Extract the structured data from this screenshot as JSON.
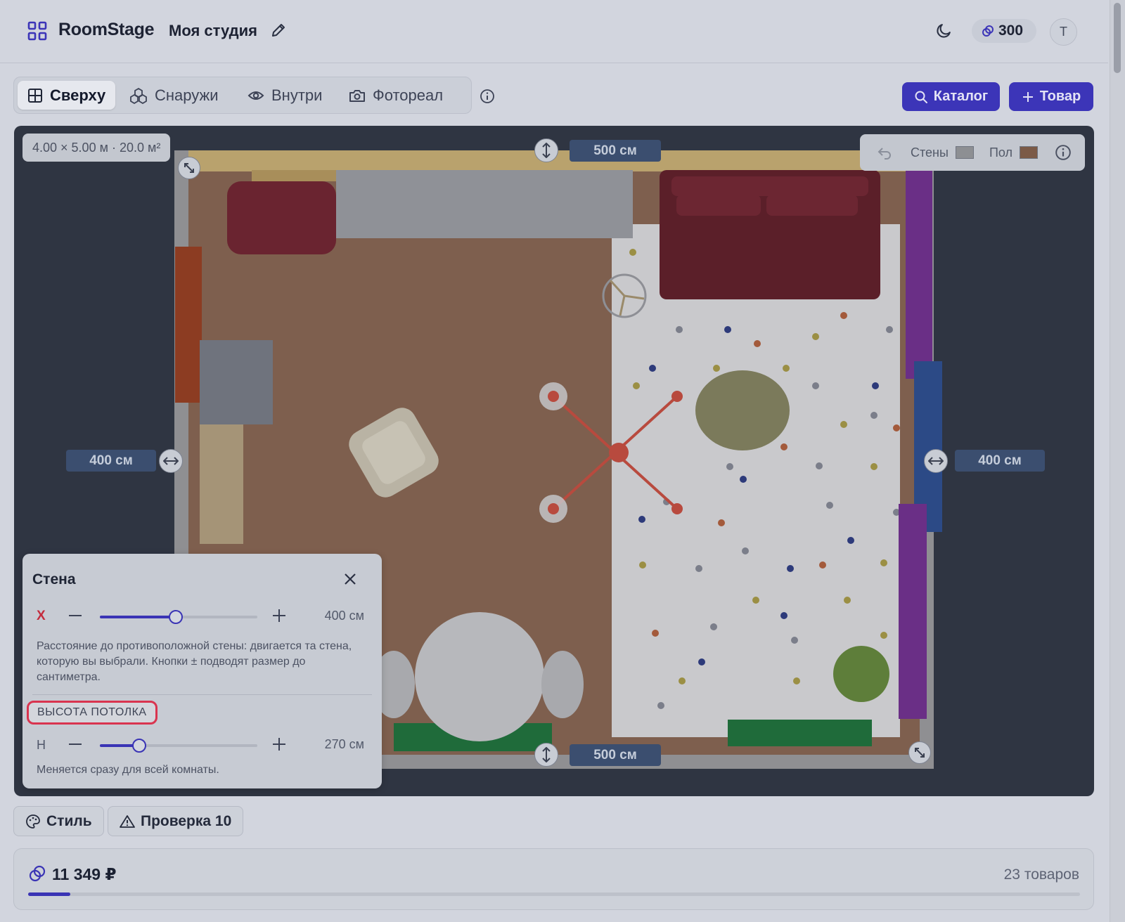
{
  "header": {
    "app_name": "RoomStage",
    "project_name": "Моя студия",
    "coins": "300",
    "avatar_letter": "T"
  },
  "view_tabs": [
    {
      "label": "Сверху",
      "icon": "grid-top-view-icon",
      "active": true
    },
    {
      "label": "Снаружи",
      "icon": "cubes-icon",
      "active": false
    },
    {
      "label": "Внутри",
      "icon": "eye-icon",
      "active": false
    },
    {
      "label": "Фотореал",
      "icon": "camera-icon",
      "active": false
    }
  ],
  "actions": {
    "catalog_label": "Каталог",
    "add_item_label": "Товар"
  },
  "canvas": {
    "room_size": "4.00 × 5.00 м · 20.0 м²",
    "dim_top": "500 см",
    "dim_bottom": "500 см",
    "dim_left": "400 см",
    "dim_right": "400 см",
    "walls_label": "Стены",
    "floor_label": "Пол",
    "walls_color": "#8d8f93",
    "floor_color": "#7b5a47"
  },
  "wall_panel": {
    "title": "Стена",
    "x_axis": "X",
    "x_value": "400 см",
    "x_level": 0.48,
    "x_hint": "Расстояние до противоположной стены: двигается та стена, которую вы выбрали. Кнопки ± подводят размер до сантиметра.",
    "ceiling_label": "ВЫСОТА ПОТОЛКА",
    "h_axis": "H",
    "h_value": "270 см",
    "h_level": 0.25,
    "h_hint": "Меняется сразу для всей комнаты."
  },
  "bottom": {
    "style_label": "Стиль",
    "check_label": "Проверка 10",
    "total_price": "11 349 ₽",
    "items_count": "23 товаров",
    "budget_fill": 0.04
  },
  "colors": {
    "accent": "#3a34b5",
    "canvas_bg": "#2f3542",
    "dim_label_bg": "#3b4e6f",
    "highlight": "#d9344f"
  }
}
